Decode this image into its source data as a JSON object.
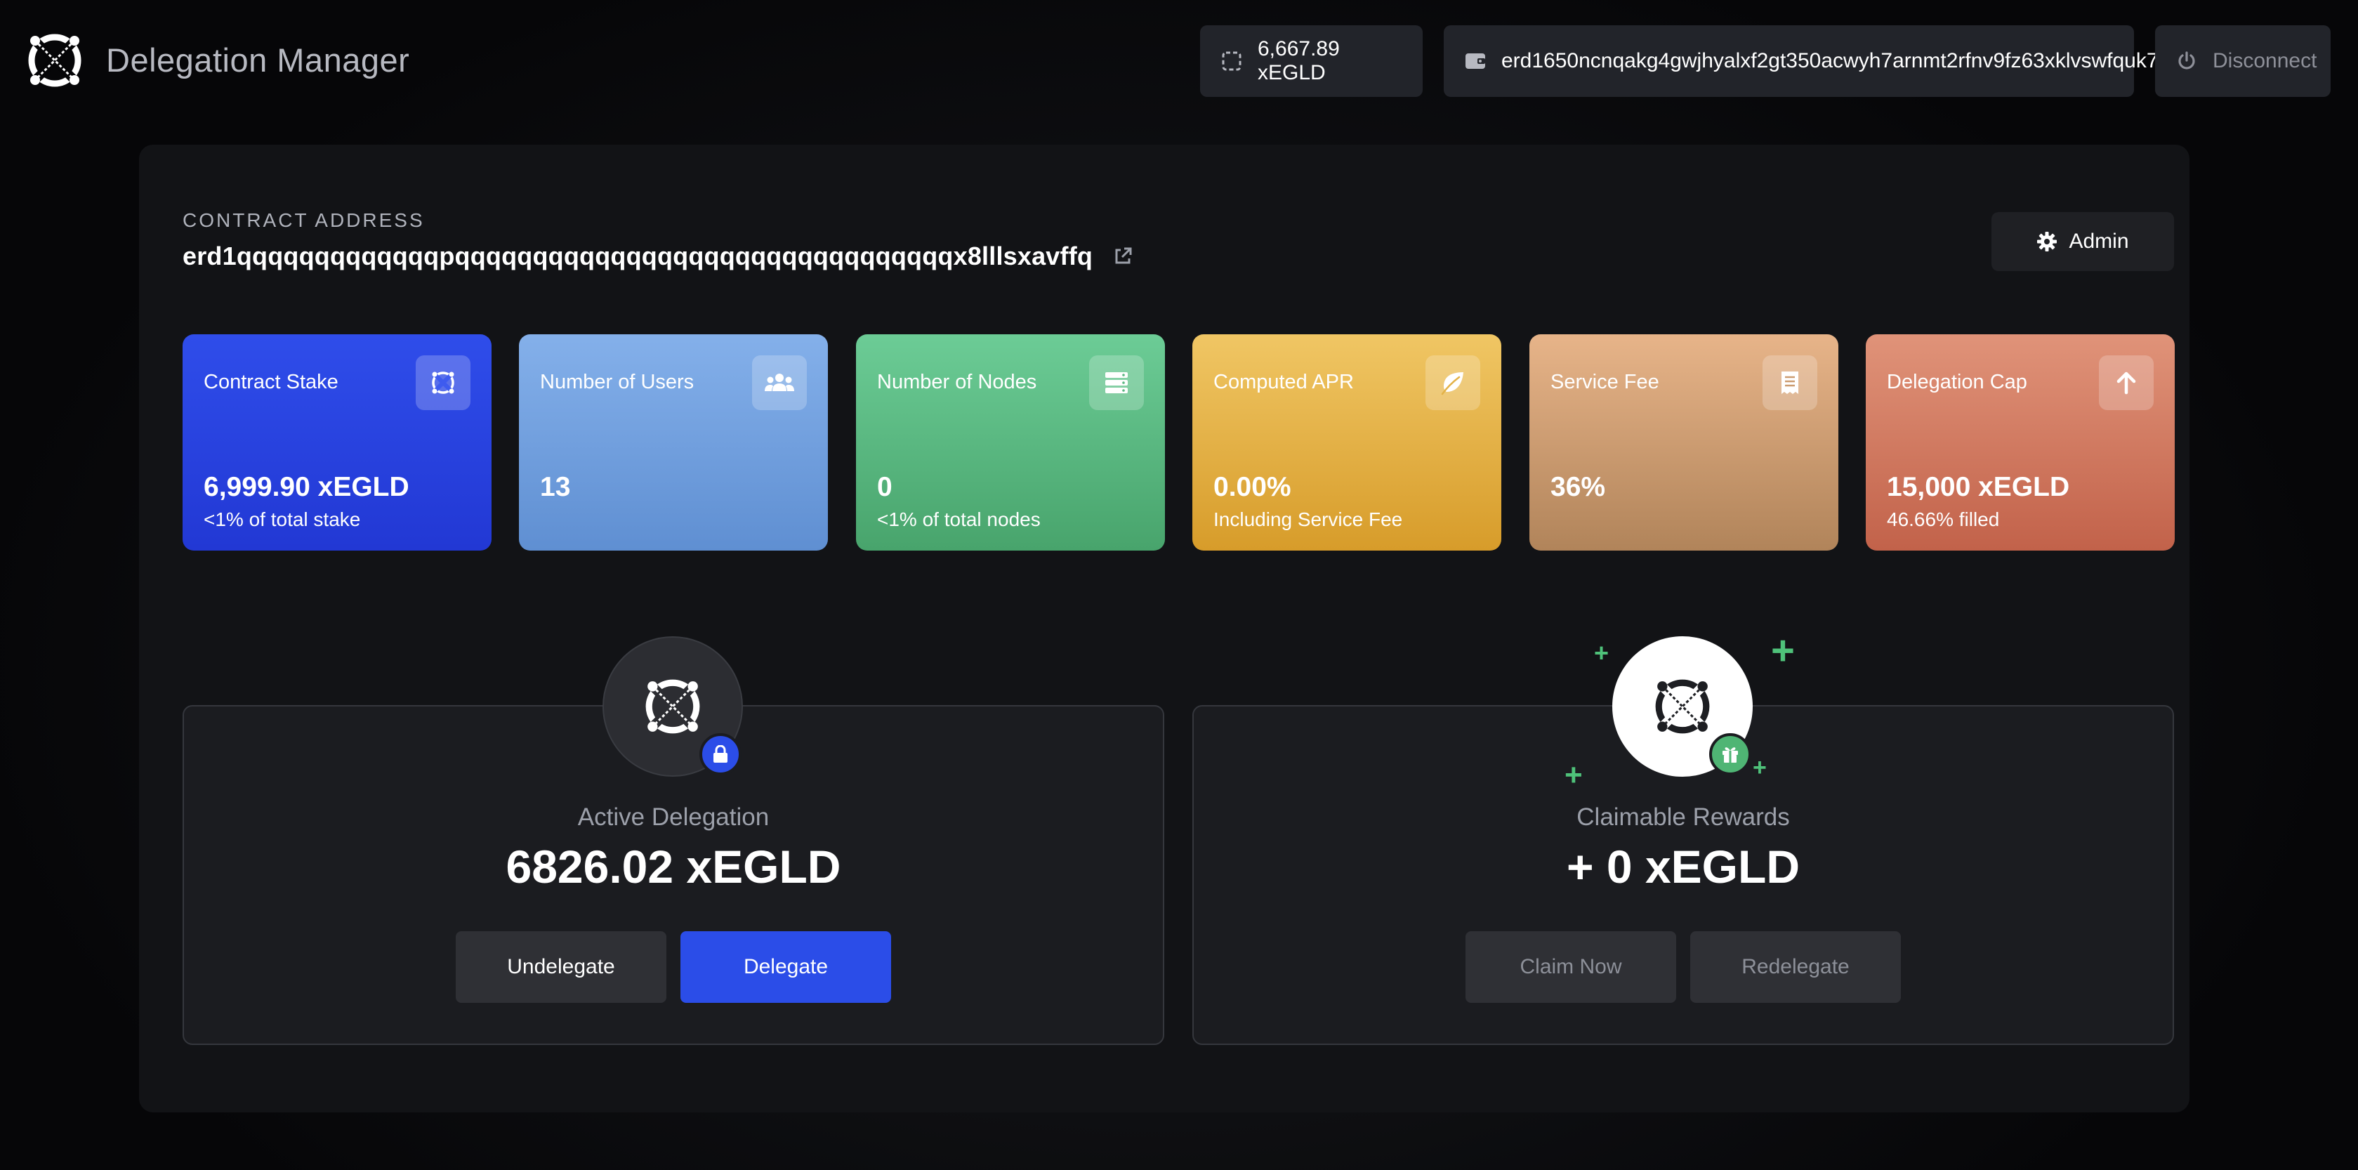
{
  "header": {
    "app_title": "Delegation Manager",
    "balance": "6,667.89 xEGLD",
    "wallet_address": "erd1650ncnqakg4gwjhyalxf2gt350acwyh7arnmt2rfnv9fz63xklvswfquk7",
    "disconnect_label": "Disconnect"
  },
  "contract": {
    "label": "CONTRACT ADDRESS",
    "address": "erd1qqqqqqqqqqqqqpqqqqqqqqqqqqqqqqqqqqqqqqqqqqqqqqx8lllsxavffq",
    "admin_label": "Admin"
  },
  "stats": [
    {
      "title": "Contract Stake",
      "value": "6,999.90 xEGLD",
      "sub": "<1% of total stake",
      "icon": "egld-icon"
    },
    {
      "title": "Number of Users",
      "value": "13",
      "sub": "",
      "icon": "users-icon"
    },
    {
      "title": "Number of Nodes",
      "value": "0",
      "sub": "<1% of total nodes",
      "icon": "server-icon"
    },
    {
      "title": "Computed APR",
      "value": "0.00%",
      "sub": "Including Service Fee",
      "icon": "leaf-icon"
    },
    {
      "title": "Service Fee",
      "value": "36%",
      "sub": "",
      "icon": "receipt-icon"
    },
    {
      "title": "Delegation Cap",
      "value": "15,000 xEGLD",
      "sub": "46.66% filled",
      "icon": "arrow-up-icon"
    }
  ],
  "active_delegation": {
    "title": "Active Delegation",
    "value": "6826.02 xEGLD",
    "undelegate_label": "Undelegate",
    "delegate_label": "Delegate"
  },
  "claimable_rewards": {
    "title": "Claimable Rewards",
    "value": "+ 0 xEGLD",
    "claim_label": "Claim Now",
    "redelegate_label": "Redelegate"
  },
  "colors": {
    "accent_blue": "#2b4de8",
    "reward_green": "#4fc27a"
  }
}
